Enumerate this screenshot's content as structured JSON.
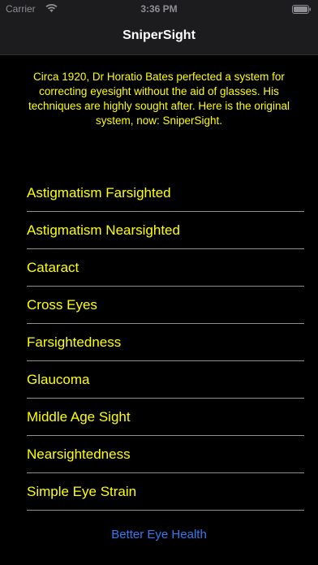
{
  "status_bar": {
    "carrier": "Carrier",
    "time": "3:36 PM",
    "wifi_icon": "wifi-icon",
    "battery_icon": "battery-icon"
  },
  "nav": {
    "title": "SniperSight"
  },
  "intro": {
    "text": "Circa 1920, Dr Horatio Bates perfected a system for correcting eyesight without the aid of glasses.  His techniques are highly sought after. Here is the original system, now: SniperSight."
  },
  "menu": {
    "items": [
      {
        "label": "Astigmatism Farsighted"
      },
      {
        "label": "Astigmatism Nearsighted"
      },
      {
        "label": "Cataract"
      },
      {
        "label": "Cross Eyes"
      },
      {
        "label": "Farsightedness"
      },
      {
        "label": "Glaucoma"
      },
      {
        "label": "Middle Age Sight"
      },
      {
        "label": "Nearsightedness"
      },
      {
        "label": "Simple Eye Strain"
      }
    ]
  },
  "footer": {
    "link_label": "Better Eye Health"
  },
  "colors": {
    "background": "#000000",
    "text_accent": "#ffff00",
    "link": "#2e7cf6",
    "separator": "#8e8e93"
  }
}
